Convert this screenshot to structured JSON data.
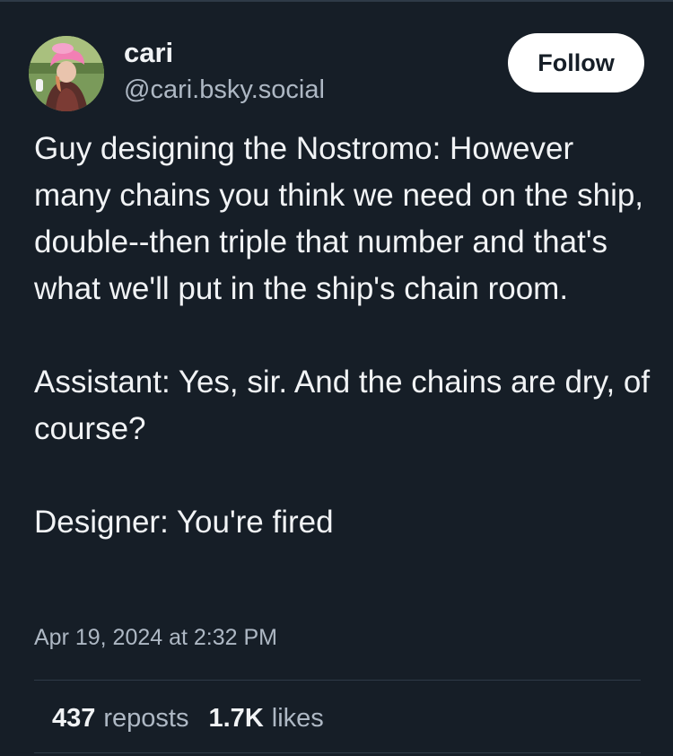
{
  "author": {
    "display_name": "cari",
    "handle": "@cari.bsky.social"
  },
  "follow_label": "Follow",
  "post": {
    "paragraphs": [
      "Guy designing the Nostromo: However many chains you think we need on the ship, double--then triple that number and that's what we'll put in the ship's chain room.",
      "Assistant: Yes, sir. And the chains are dry, of course?",
      "Designer: You're fired"
    ],
    "timestamp": "Apr 19, 2024 at 2:32 PM"
  },
  "stats": {
    "reposts_count": "437",
    "reposts_label": "reposts",
    "likes_count": "1.7K",
    "likes_label": "likes"
  },
  "colors": {
    "background": "#161e27",
    "text_primary": "#f1f3f5",
    "text_secondary": "#aeb8c4",
    "divider": "#2e3a47",
    "follow_button_bg": "#ffffff"
  }
}
